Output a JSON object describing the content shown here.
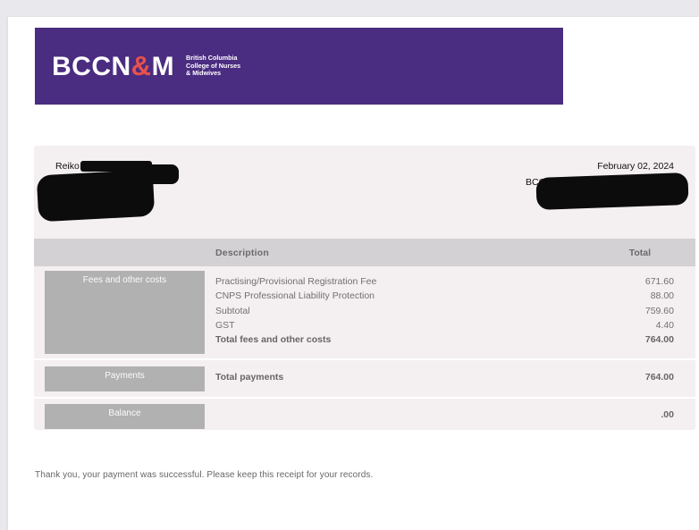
{
  "header": {
    "logo_mark_a": "BCCN",
    "logo_mark_amp": "&",
    "logo_mark_b": "M",
    "logo_line_1": "British Columbia",
    "logo_line_2": "College of Nurses",
    "logo_line_3": "& Midwives",
    "brand_color": "#4a2c80",
    "accent_color": "#e8524a"
  },
  "recipient": {
    "name": "Reiko",
    "date": "February 02, 2024",
    "account_label": "BCCNM Account"
  },
  "table": {
    "col_description": "Description",
    "col_total": "Total"
  },
  "fees": {
    "section_label": "Fees and other costs",
    "items": [
      {
        "label": "Practising/Provisional Registration Fee",
        "amount": "671.60"
      },
      {
        "label": "CNPS Professional Liability Protection",
        "amount": "88.00"
      },
      {
        "label": "Subtotal",
        "amount": "759.60"
      },
      {
        "label": "GST",
        "amount": "4.40"
      }
    ],
    "total_label": "Total fees and other costs",
    "total_amount": "764.00"
  },
  "payments": {
    "section_label": "Payments",
    "total_label": "Total payments",
    "total_amount": "764.00"
  },
  "balance": {
    "section_label": "Balance",
    "amount": ".00"
  },
  "footer": {
    "message": "Thank you, your payment was successful. Please keep this receipt for your records."
  }
}
